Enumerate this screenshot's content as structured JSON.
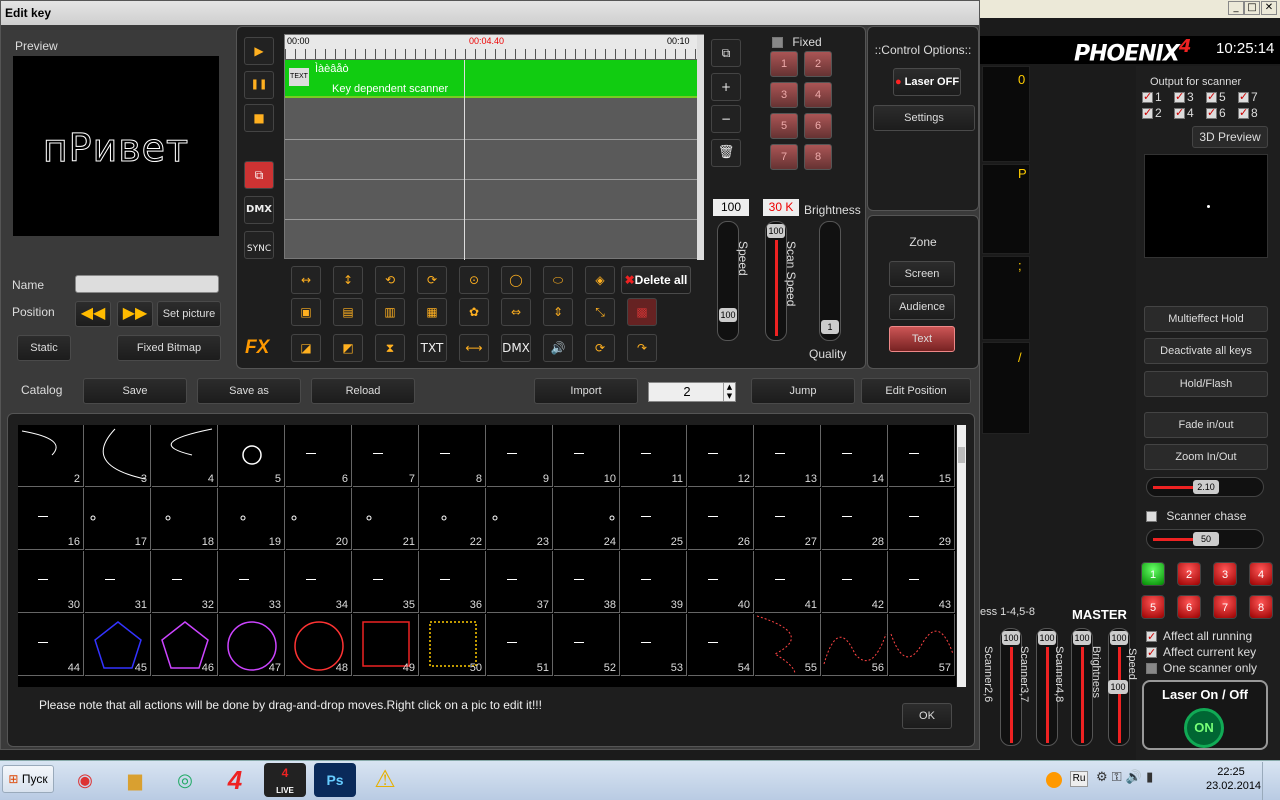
{
  "main": {
    "window_buttons": [
      "_",
      "□",
      "✕"
    ],
    "logo": "PHOENIX",
    "logo_version": "4",
    "clock": "10:25:14",
    "mid_chars": [
      "0",
      "P",
      ";",
      "/"
    ],
    "output_label": "Output for scanner",
    "scanners": [
      "1",
      "3",
      "5",
      "7",
      "2",
      "4",
      "6",
      "8"
    ],
    "preview3d": "3D Preview",
    "buttons": [
      "Multieffect Hold",
      "Deactivate all keys",
      "Hold/Flash",
      "Fade in/out",
      "Zoom In/Out"
    ],
    "slider1": "2.10",
    "slider2": "50",
    "scanner_chase": "Scanner chase",
    "scanner_buttons": [
      "1",
      "2",
      "3",
      "4",
      "5",
      "6",
      "7",
      "8"
    ],
    "ess_label": "ess 1-4,5-8",
    "master": "MASTER",
    "vsliders": [
      {
        "label": "Scanner2,6",
        "value": "100"
      },
      {
        "label": "Scanner3,7",
        "value": "100"
      },
      {
        "label": "Scanner4,8",
        "value": "100"
      },
      {
        "label": "Brightness",
        "value": "100"
      },
      {
        "label": "Speed",
        "value": "100"
      }
    ],
    "checks": [
      {
        "label": "Affect all running",
        "on": true
      },
      {
        "label": "Affect current key",
        "on": true
      },
      {
        "label": "One scanner only",
        "on": false
      }
    ],
    "laser": {
      "title": "Laser On / Off",
      "state": "ON"
    }
  },
  "dialog": {
    "title": "Edit key",
    "preview_label": "Preview",
    "preview_text": "пРивет",
    "name_label": "Name",
    "name_value": "",
    "position_label": "Position",
    "set_picture": "Set picture",
    "static": "Static",
    "fixed_bitmap": "Fixed Bitmap",
    "left_icons": [
      "▶",
      "❚❚",
      "■",
      "⧉",
      "DMX",
      "SYNC"
    ],
    "timeline": {
      "t_start": "00:00",
      "t_mid": "00:04.40",
      "t_end": "00:10",
      "track_title": "Ìàèâåò",
      "track_sub": "Key dependent scanner",
      "track_badge": "TEXT"
    },
    "right_icons": [
      "⧉",
      "+",
      "−",
      "🗑"
    ],
    "fixed_label": "Fixed",
    "fixed_buttons": [
      "1",
      "2",
      "3",
      "4",
      "5",
      "6",
      "7",
      "8"
    ],
    "control_options": "::Control Options::",
    "laser_off": "Laser OFF",
    "settings": "Settings",
    "speed_val": "100",
    "speed_label": "Speed",
    "speed_knob": "100",
    "scan_val": "30 K",
    "scan_label": "Scan Speed",
    "scan_knob": "100",
    "brightness_label": "Brightness",
    "quality_label": "Quality",
    "quality_knob": "1",
    "zone_label": "Zone",
    "zone_buttons": [
      "Screen",
      "Audience",
      "Text"
    ],
    "fx_label": "FX",
    "fx_row1": [
      "↔",
      "↕",
      "⟲",
      "⟳",
      "⊙",
      "◯",
      "⬭",
      "◈"
    ],
    "fx_row2": [
      "▣",
      "▤",
      "▥",
      "▦",
      "✿",
      "⇔",
      "⇕",
      "⤡",
      "▩"
    ],
    "fx_row3": [
      "◪",
      "◩",
      "⧗",
      "TXT",
      "⟷",
      "DMX",
      "🔊",
      "⟳",
      "↷"
    ],
    "delete_all": "Delete all",
    "catalog": "Catalog",
    "save": "Save",
    "save_as": "Save as",
    "reload": "Reload",
    "import": "Import",
    "spinner_value": "2",
    "jump": "Jump",
    "edit_position": "Edit Position",
    "grid_numbers": [
      "2",
      "3",
      "4",
      "5",
      "6",
      "7",
      "8",
      "9",
      "10",
      "11",
      "12",
      "13",
      "14",
      "15",
      "16",
      "17",
      "18",
      "19",
      "20",
      "21",
      "22",
      "23",
      "24",
      "25",
      "26",
      "27",
      "28",
      "29",
      "30",
      "31",
      "32",
      "33",
      "34",
      "35",
      "36",
      "37",
      "38",
      "39",
      "40",
      "41",
      "42",
      "43",
      "44",
      "45",
      "46",
      "47",
      "48",
      "49",
      "50",
      "51",
      "52",
      "53",
      "54",
      "55",
      "56",
      "57"
    ],
    "note": "Please note that all actions will be done by drag-and-drop moves.Right click on a pic to edit it!!!",
    "ok": "OK"
  },
  "taskbar": {
    "start": "Пуск",
    "lang": "Ru",
    "time": "22:25",
    "date": "23.02.2014",
    "apps": [
      "chrome-icon",
      "folder-icon",
      "app-icon",
      "phoenix4-icon",
      "phoenix4-live-icon",
      "photoshop-icon",
      "warning-icon"
    ],
    "ps": "Ps",
    "live": "LIVE",
    "four": "4"
  }
}
